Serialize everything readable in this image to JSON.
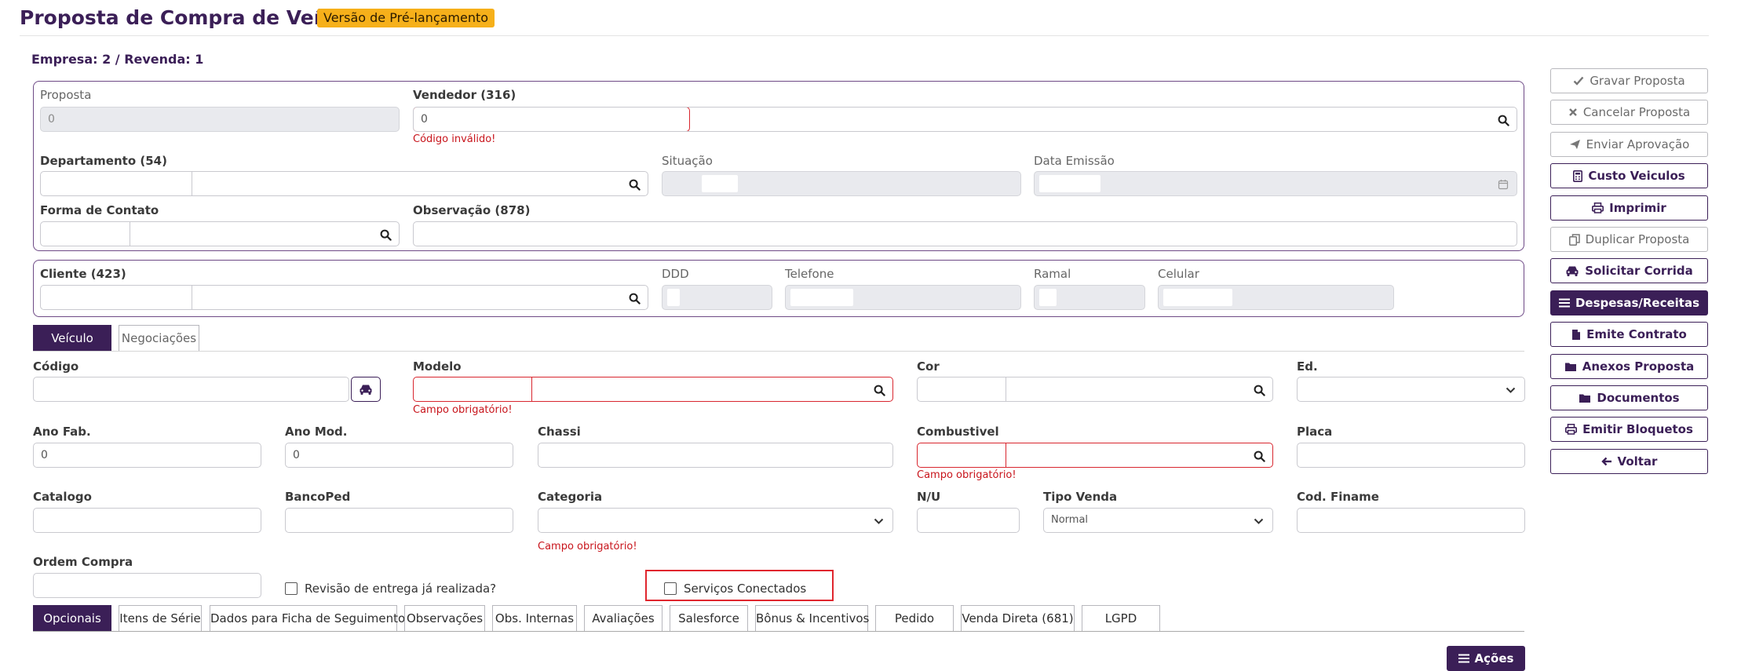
{
  "header": {
    "title": "Proposta de Compra de Veículo",
    "badge": "Versão de Pré-lançamento",
    "empresa": "Empresa: 2 / Revenda: 1"
  },
  "proposal": {
    "proposta_label": "Proposta",
    "proposta_value": "0",
    "vendedor_label": "Vendedor (316)",
    "vendedor_code": "0",
    "vendedor_error": "Código inválido!",
    "departamento_label": "Departamento (54)",
    "situacao_label": "Situação",
    "data_emissao_label": "Data Emissão",
    "forma_contato_label": "Forma de Contato",
    "observacao_label": "Observação (878)"
  },
  "client": {
    "cliente_label": "Cliente (423)",
    "ddd_label": "DDD",
    "telefone_label": "Telefone",
    "ramal_label": "Ramal",
    "celular_label": "Celular"
  },
  "vehicle_tabs": [
    "Veículo",
    "Negociações"
  ],
  "vehicle": {
    "codigo_label": "Código",
    "modelo_label": "Modelo",
    "modelo_error": "Campo obrigatório!",
    "cor_label": "Cor",
    "ed_label": "Ed.",
    "ano_fab_label": "Ano Fab.",
    "ano_fab_value": "0",
    "ano_mod_label": "Ano Mod.",
    "ano_mod_value": "0",
    "chassi_label": "Chassi",
    "combustivel_label": "Combustivel",
    "combustivel_error": "Campo obrigatório!",
    "placa_label": "Placa",
    "catalogo_label": "Catalogo",
    "bancoped_label": "BancoPed",
    "categoria_label": "Categoria",
    "categoria_error": "Campo obrigatório!",
    "nu_label": "N/U",
    "tipo_venda_label": "Tipo Venda",
    "tipo_venda_value": "Normal",
    "cod_finame_label": "Cod. Finame",
    "ordem_compra_label": "Ordem Compra",
    "revisao_label": "Revisão de entrega já realizada?",
    "servicos_label": "Serviços Conectados"
  },
  "bottom_tabs": [
    "Opcionais",
    "Itens de Série",
    "Dados para Ficha de Seguimento",
    "Observações",
    "Obs. Internas",
    "Avaliações",
    "Salesforce",
    "Bônus & Incentivos",
    "Pedido",
    "Venda Direta (681)",
    "LGPD"
  ],
  "acoes_label": "Ações",
  "sidebar": [
    {
      "label": "Gravar Proposta",
      "icon": "check-icon",
      "state": "disabled"
    },
    {
      "label": "Cancelar Proposta",
      "icon": "times-icon",
      "state": "disabled"
    },
    {
      "label": "Enviar Aprovação",
      "icon": "paper-plane-icon",
      "state": "disabled"
    },
    {
      "label": "Custo Veiculos",
      "icon": "calculator-icon",
      "state": "enabled"
    },
    {
      "label": "Imprimir",
      "icon": "print-icon",
      "state": "enabled"
    },
    {
      "label": "Duplicar Proposta",
      "icon": "copy-icon",
      "state": "disabled"
    },
    {
      "label": "Solicitar Corrida",
      "icon": "car-icon",
      "state": "enabled"
    },
    {
      "label": "Despesas/Receitas",
      "icon": "bars-icon",
      "state": "solid"
    },
    {
      "label": "Emite Contrato",
      "icon": "file-icon",
      "state": "enabled"
    },
    {
      "label": "Anexos Proposta",
      "icon": "folder-icon",
      "state": "enabled"
    },
    {
      "label": "Documentos",
      "icon": "folder-icon",
      "state": "enabled"
    },
    {
      "label": "Emitir Bloquetos",
      "icon": "print-icon",
      "state": "enabled"
    },
    {
      "label": "Voltar",
      "icon": "arrow-left-icon",
      "state": "enabled"
    }
  ],
  "colors": {
    "accent": "#3b1f57",
    "badge": "#f6b01a",
    "error": "#d8262e"
  }
}
